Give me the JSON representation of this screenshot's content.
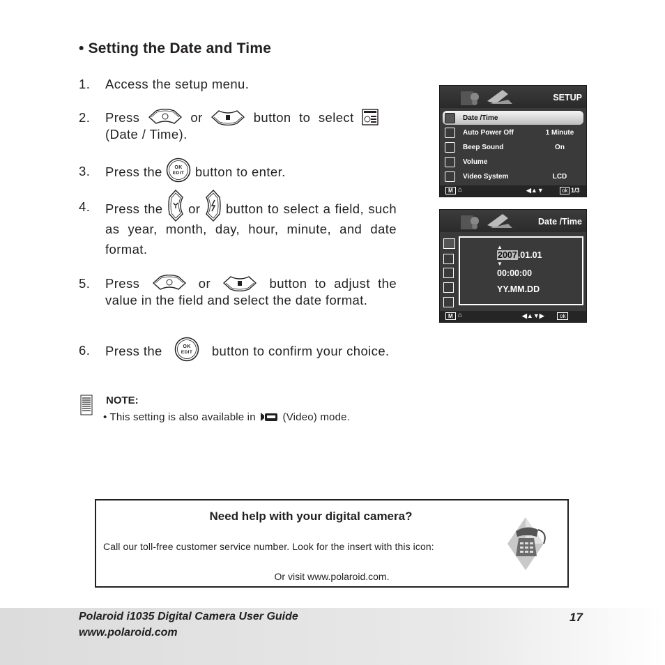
{
  "heading": "• Setting the Date and Time",
  "steps": [
    {
      "num": "1.",
      "text": "Access the setup menu."
    },
    {
      "num": "2.",
      "pre": "Press",
      "mid": "or",
      "post": "button to select",
      "tail": "(Date / Time)."
    },
    {
      "num": "3.",
      "pre": "Press the",
      "post": "button to enter."
    },
    {
      "num": "4.",
      "pre": "Press the",
      "mid": "or",
      "post": "button to select a field,",
      "tail": "such as year, month, day, hour, minute, and date format."
    },
    {
      "num": "5.",
      "pre": "Press",
      "mid": "or",
      "post": "button to adjust the",
      "tail": "value in the field and select the date format."
    },
    {
      "num": "6.",
      "pre": "Press the",
      "post": "button to confirm your",
      "tail": "choice."
    }
  ],
  "ok_button": {
    "line1": "OK",
    "line2": "EDIT"
  },
  "note": {
    "label": "NOTE:",
    "pre": "• This setting is also available in",
    "post": "(Video) mode."
  },
  "setup_screen": {
    "title": "SETUP",
    "rows": [
      {
        "label": "Date /Time",
        "value": "",
        "icon": "date-time-icon",
        "selected": true
      },
      {
        "label": "Auto Power Off",
        "value": "1 Minute",
        "icon": "power-icon"
      },
      {
        "label": "Beep Sound",
        "value": "On",
        "icon": "speaker-icon"
      },
      {
        "label": "Volume",
        "value": "",
        "icon": "volume-bars-icon"
      },
      {
        "label": "Video System",
        "value": "LCD",
        "icon": "tv-icon"
      }
    ],
    "bottom": {
      "menu": "M",
      "nav": "◀▲▼",
      "ok": "ok",
      "page": "1/3"
    }
  },
  "datetime_screen": {
    "title": "Date /Time",
    "year": "2007",
    "date_rest": ".01.01",
    "time": "00:00:00",
    "format": "YY.MM.DD",
    "bottom": {
      "menu": "M",
      "nav": "◀▲▼▶",
      "ok": "ok"
    }
  },
  "help_box": {
    "title": "Need help with your digital camera?",
    "line1": "Call our toll-free customer service number. Look for the insert with this icon:",
    "line2": "Or visit www.polaroid.com."
  },
  "footer": {
    "title": "Polaroid i1035 Digital Camera User Guide",
    "url": "www.polaroid.com",
    "page": "17"
  }
}
